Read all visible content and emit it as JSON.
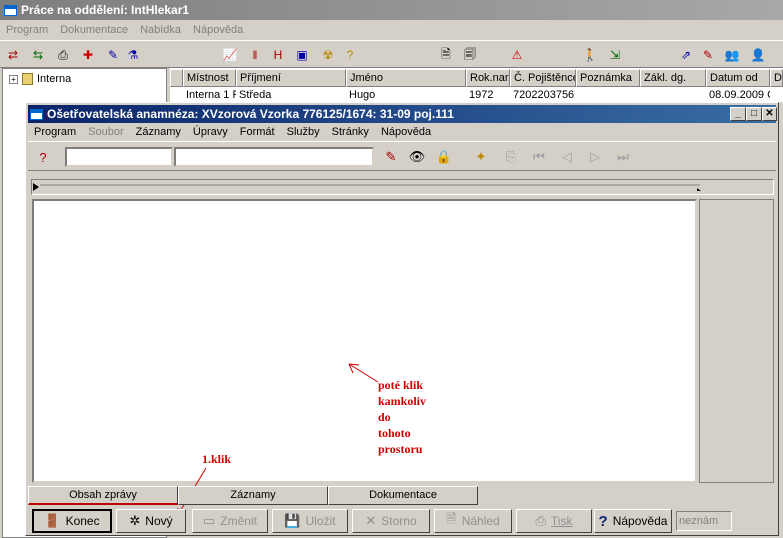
{
  "outer_window": {
    "title": "Práce na oddělení: IntHlekar1",
    "menu": [
      "Program",
      "Dokumentace",
      "Nabídka",
      "Nápověda"
    ]
  },
  "tree": {
    "root_label": "Interna"
  },
  "grid": {
    "columns": [
      "Místnost",
      "Příjmení",
      "Jméno",
      "Rok.nar.",
      "Č. Pojištěnce",
      "Poznámka",
      "Zákl. dg.",
      "Datum od",
      "D"
    ],
    "row": [
      "Interna 1 F",
      "Středa",
      "Hugo",
      "1972",
      "7202203756",
      "",
      "",
      "08.09.2009 C",
      ""
    ]
  },
  "inner_window": {
    "title": "Ošetřovatelská anamnéza: XVzorová Vzorka 776125/1674: 31-09 poj.111",
    "controls": {
      "minimize": "_",
      "maximize": "□",
      "close": "✕"
    },
    "menu": [
      {
        "label": "Program",
        "disabled": false
      },
      {
        "label": "Soubor",
        "disabled": true
      },
      {
        "label": "Záznamy",
        "disabled": false
      },
      {
        "label": "Úpravy",
        "disabled": false
      },
      {
        "label": "Formát",
        "disabled": false
      },
      {
        "label": "Služby",
        "disabled": false
      },
      {
        "label": "Stránky",
        "disabled": false
      },
      {
        "label": "Nápověda",
        "disabled": false
      }
    ],
    "field1_value": "",
    "field2_value": ""
  },
  "annotations": {
    "first_click": "1.klik",
    "then_click": [
      "poté klik",
      "kamkoliv",
      "do",
      "tohoto",
      "prostoru"
    ],
    "color": "#d00000"
  },
  "tabs": [
    "Obsah zprávy",
    "Záznamy",
    "Dokumentace"
  ],
  "buttons": {
    "konec": "Konec",
    "novy": "Nový",
    "zmenit": "Změnit",
    "ulozit": "Uložit",
    "storno": "Storno",
    "nahled": "Náhled",
    "tisk": "Tisk",
    "napoveda": "Nápověda",
    "neznam": "neznám"
  },
  "colors": {
    "title_active": "#0a246a",
    "title_inactive": "#808080",
    "face": "#d4d0c8"
  }
}
